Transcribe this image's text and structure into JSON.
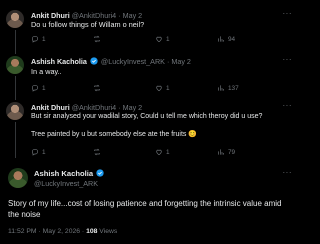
{
  "icons": {
    "more": "more-horizontal-icon",
    "reply": "reply-icon",
    "repost": "repost-icon",
    "like": "like-icon",
    "views": "views-icon",
    "verified": "verified-badge-icon"
  },
  "colors": {
    "background": "#000000",
    "text": "#e7e9ea",
    "muted": "#71767b",
    "verified": "#1d9bf0"
  },
  "more_glyph": "···",
  "replies": [
    {
      "name": "Ankit Dhuri",
      "handle": "@AnkitDhuri4",
      "date": "· May 2",
      "verified": false,
      "text": "Do u follow things of Willam o neil?",
      "reply_count": "1",
      "repost_count": "",
      "like_count": "1",
      "view_count": "94"
    },
    {
      "name": "Ashish Kacholia",
      "handle": "@LuckyInvest_ARK",
      "date": "· May 2",
      "verified": true,
      "text": "In a way..",
      "reply_count": "1",
      "repost_count": "",
      "like_count": "1",
      "view_count": "137"
    },
    {
      "name": "Ankit Dhuri",
      "handle": "@AnkitDhuri4",
      "date": "· May 2",
      "verified": false,
      "text": "But sir analysed your wadilal story, Could u tell me which theroy did u use?",
      "text2": "Tree painted by u but somebody else ate the fruits 😊",
      "reply_count": "1",
      "repost_count": "",
      "like_count": "1",
      "view_count": "79"
    }
  ],
  "main_post": {
    "name": "Ashish Kacholia",
    "handle": "@LuckyInvest_ARK",
    "verified": true,
    "text": "Story of my life...cost of losing patience and forgetting the intrinsic value amid the noise",
    "time": "11:52 PM · May 2, 2026 · ",
    "views": "108",
    "views_label": " Views"
  }
}
